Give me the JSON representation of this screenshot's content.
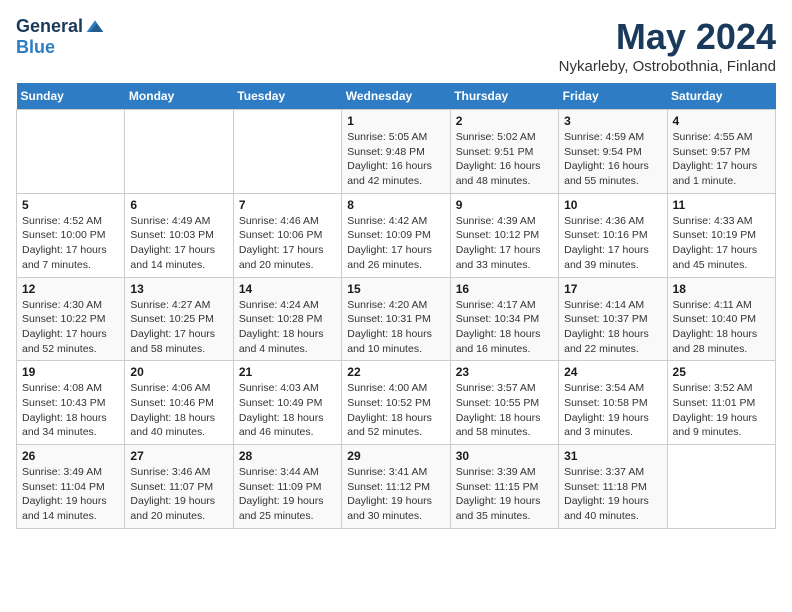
{
  "header": {
    "logo_general": "General",
    "logo_blue": "Blue",
    "month": "May 2024",
    "location": "Nykarleby, Ostrobothnia, Finland"
  },
  "weekdays": [
    "Sunday",
    "Monday",
    "Tuesday",
    "Wednesday",
    "Thursday",
    "Friday",
    "Saturday"
  ],
  "weeks": [
    [
      {
        "day": "",
        "info": ""
      },
      {
        "day": "",
        "info": ""
      },
      {
        "day": "",
        "info": ""
      },
      {
        "day": "1",
        "info": "Sunrise: 5:05 AM\nSunset: 9:48 PM\nDaylight: 16 hours and 42 minutes."
      },
      {
        "day": "2",
        "info": "Sunrise: 5:02 AM\nSunset: 9:51 PM\nDaylight: 16 hours and 48 minutes."
      },
      {
        "day": "3",
        "info": "Sunrise: 4:59 AM\nSunset: 9:54 PM\nDaylight: 16 hours and 55 minutes."
      },
      {
        "day": "4",
        "info": "Sunrise: 4:55 AM\nSunset: 9:57 PM\nDaylight: 17 hours and 1 minute."
      }
    ],
    [
      {
        "day": "5",
        "info": "Sunrise: 4:52 AM\nSunset: 10:00 PM\nDaylight: 17 hours and 7 minutes."
      },
      {
        "day": "6",
        "info": "Sunrise: 4:49 AM\nSunset: 10:03 PM\nDaylight: 17 hours and 14 minutes."
      },
      {
        "day": "7",
        "info": "Sunrise: 4:46 AM\nSunset: 10:06 PM\nDaylight: 17 hours and 20 minutes."
      },
      {
        "day": "8",
        "info": "Sunrise: 4:42 AM\nSunset: 10:09 PM\nDaylight: 17 hours and 26 minutes."
      },
      {
        "day": "9",
        "info": "Sunrise: 4:39 AM\nSunset: 10:12 PM\nDaylight: 17 hours and 33 minutes."
      },
      {
        "day": "10",
        "info": "Sunrise: 4:36 AM\nSunset: 10:16 PM\nDaylight: 17 hours and 39 minutes."
      },
      {
        "day": "11",
        "info": "Sunrise: 4:33 AM\nSunset: 10:19 PM\nDaylight: 17 hours and 45 minutes."
      }
    ],
    [
      {
        "day": "12",
        "info": "Sunrise: 4:30 AM\nSunset: 10:22 PM\nDaylight: 17 hours and 52 minutes."
      },
      {
        "day": "13",
        "info": "Sunrise: 4:27 AM\nSunset: 10:25 PM\nDaylight: 17 hours and 58 minutes."
      },
      {
        "day": "14",
        "info": "Sunrise: 4:24 AM\nSunset: 10:28 PM\nDaylight: 18 hours and 4 minutes."
      },
      {
        "day": "15",
        "info": "Sunrise: 4:20 AM\nSunset: 10:31 PM\nDaylight: 18 hours and 10 minutes."
      },
      {
        "day": "16",
        "info": "Sunrise: 4:17 AM\nSunset: 10:34 PM\nDaylight: 18 hours and 16 minutes."
      },
      {
        "day": "17",
        "info": "Sunrise: 4:14 AM\nSunset: 10:37 PM\nDaylight: 18 hours and 22 minutes."
      },
      {
        "day": "18",
        "info": "Sunrise: 4:11 AM\nSunset: 10:40 PM\nDaylight: 18 hours and 28 minutes."
      }
    ],
    [
      {
        "day": "19",
        "info": "Sunrise: 4:08 AM\nSunset: 10:43 PM\nDaylight: 18 hours and 34 minutes."
      },
      {
        "day": "20",
        "info": "Sunrise: 4:06 AM\nSunset: 10:46 PM\nDaylight: 18 hours and 40 minutes."
      },
      {
        "day": "21",
        "info": "Sunrise: 4:03 AM\nSunset: 10:49 PM\nDaylight: 18 hours and 46 minutes."
      },
      {
        "day": "22",
        "info": "Sunrise: 4:00 AM\nSunset: 10:52 PM\nDaylight: 18 hours and 52 minutes."
      },
      {
        "day": "23",
        "info": "Sunrise: 3:57 AM\nSunset: 10:55 PM\nDaylight: 18 hours and 58 minutes."
      },
      {
        "day": "24",
        "info": "Sunrise: 3:54 AM\nSunset: 10:58 PM\nDaylight: 19 hours and 3 minutes."
      },
      {
        "day": "25",
        "info": "Sunrise: 3:52 AM\nSunset: 11:01 PM\nDaylight: 19 hours and 9 minutes."
      }
    ],
    [
      {
        "day": "26",
        "info": "Sunrise: 3:49 AM\nSunset: 11:04 PM\nDaylight: 19 hours and 14 minutes."
      },
      {
        "day": "27",
        "info": "Sunrise: 3:46 AM\nSunset: 11:07 PM\nDaylight: 19 hours and 20 minutes."
      },
      {
        "day": "28",
        "info": "Sunrise: 3:44 AM\nSunset: 11:09 PM\nDaylight: 19 hours and 25 minutes."
      },
      {
        "day": "29",
        "info": "Sunrise: 3:41 AM\nSunset: 11:12 PM\nDaylight: 19 hours and 30 minutes."
      },
      {
        "day": "30",
        "info": "Sunrise: 3:39 AM\nSunset: 11:15 PM\nDaylight: 19 hours and 35 minutes."
      },
      {
        "day": "31",
        "info": "Sunrise: 3:37 AM\nSunset: 11:18 PM\nDaylight: 19 hours and 40 minutes."
      },
      {
        "day": "",
        "info": ""
      }
    ]
  ]
}
